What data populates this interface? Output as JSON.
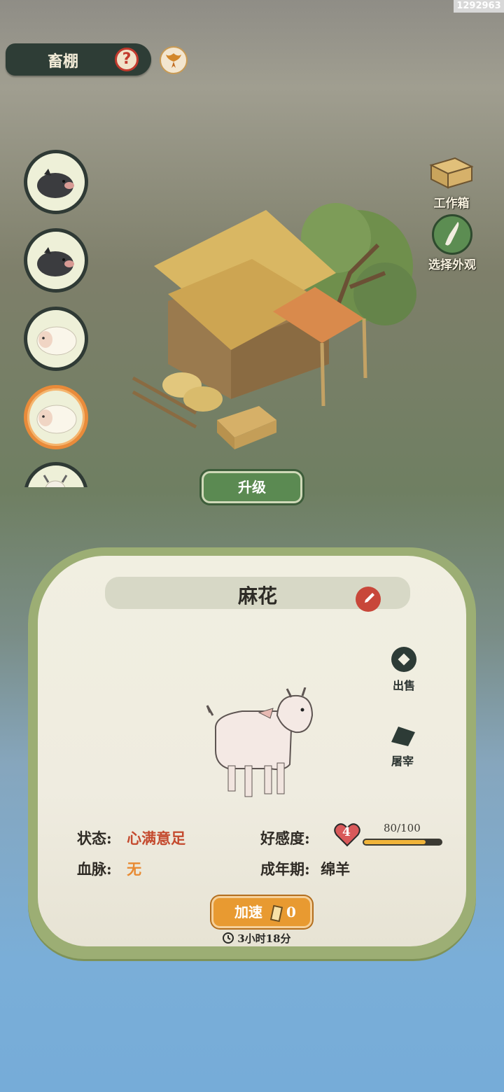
{
  "corner_id": "1292963",
  "header": {
    "title": "畜棚",
    "help_glyph": "?"
  },
  "animal_list": [
    {
      "kind": "black-pig",
      "selected": false
    },
    {
      "kind": "black-pig",
      "selected": false
    },
    {
      "kind": "sheep",
      "selected": false
    },
    {
      "kind": "sheep",
      "selected": true
    },
    {
      "kind": "goat",
      "selected": false
    }
  ],
  "tools": {
    "work_box": "工作箱",
    "choose_look": "选择外观"
  },
  "upgrade_label": "升级",
  "panel": {
    "name": "麻花",
    "sell_label": "出售",
    "slaughter_label": "屠宰",
    "status_label": "状态:",
    "status_value": "心满意足",
    "bloodline_label": "血脉:",
    "bloodline_value": "无",
    "affection_label": "好感度:",
    "affection_level": "4",
    "affection_progress": "80/100",
    "affection_fraction": 0.8,
    "adult_label": "成年期:",
    "adult_value": "绵羊",
    "speed_label": "加速",
    "speed_count": "0",
    "timer": "3小时18分"
  },
  "colors": {
    "accent_green": "#5b8a52",
    "accent_orange": "#e89a31",
    "status_red": "#c44a2e"
  }
}
